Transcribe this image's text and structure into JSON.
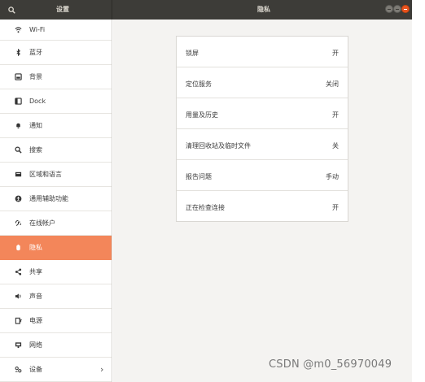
{
  "header": {
    "sidebar_title": "设置",
    "page_title": "隐私",
    "search_icon": "search-icon",
    "window_controls": [
      "minimize",
      "maximize",
      "close"
    ]
  },
  "sidebar": {
    "items": [
      {
        "label": "Wi-Fi",
        "icon": "wifi-icon"
      },
      {
        "label": "蓝牙",
        "icon": "bluetooth-icon"
      },
      {
        "label": "背景",
        "icon": "background-icon"
      },
      {
        "label": "Dock",
        "icon": "dock-icon"
      },
      {
        "label": "通知",
        "icon": "bell-icon"
      },
      {
        "label": "搜索",
        "icon": "search-icon"
      },
      {
        "label": "区域和语言",
        "icon": "region-icon"
      },
      {
        "label": "通用辅助功能",
        "icon": "accessibility-icon"
      },
      {
        "label": "在线帐户",
        "icon": "online-accounts-icon"
      },
      {
        "label": "隐私",
        "icon": "privacy-hand-icon",
        "selected": true
      },
      {
        "label": "共享",
        "icon": "share-icon"
      },
      {
        "label": "声音",
        "icon": "speaker-icon"
      },
      {
        "label": "电源",
        "icon": "power-icon"
      },
      {
        "label": "网络",
        "icon": "network-icon"
      },
      {
        "label": "设备",
        "icon": "devices-icon",
        "has_submenu": true
      }
    ]
  },
  "privacy": {
    "rows": [
      {
        "label": "锁屏",
        "value": "开"
      },
      {
        "label": "定位服务",
        "value": "关闭"
      },
      {
        "label": "用量及历史",
        "value": "开"
      },
      {
        "label": "清理回收站及临时文件",
        "value": "关"
      },
      {
        "label": "报告问题",
        "value": "手动"
      },
      {
        "label": "正在检查连接",
        "value": "开"
      }
    ]
  },
  "colors": {
    "header_bg": "#3d3c38",
    "selected_bg": "#f3865a",
    "close_button": "#e95420",
    "content_bg": "#f4f3f1"
  },
  "watermark": "CSDN @m0_56970049"
}
